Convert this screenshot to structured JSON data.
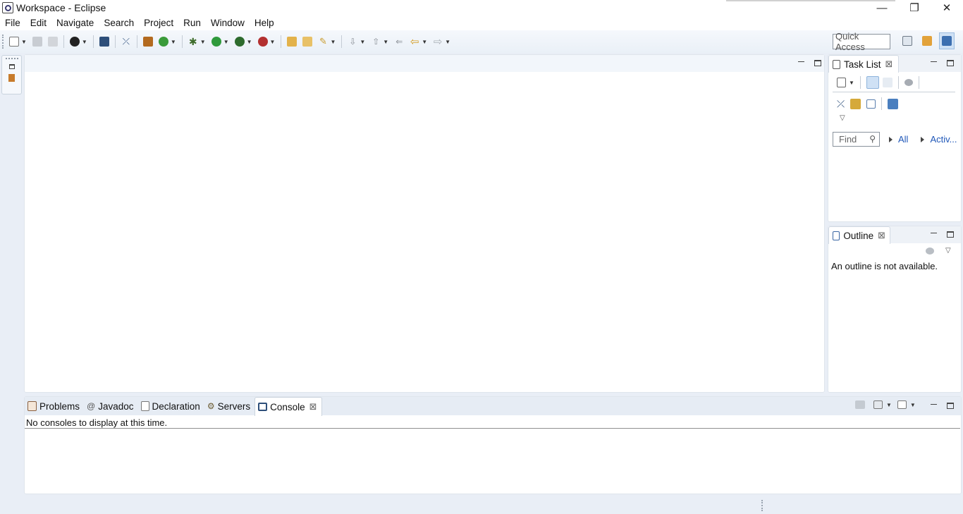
{
  "window": {
    "title": "Workspace - Eclipse",
    "controls": [
      "minimize-icon",
      "restore-icon",
      "close-icon"
    ]
  },
  "menu": [
    "File",
    "Edit",
    "Navigate",
    "Search",
    "Project",
    "Run",
    "Window",
    "Help"
  ],
  "toolbar": {
    "quick_access_placeholder": "Quick Access"
  },
  "task_list": {
    "title": "Task List",
    "find_placeholder": "Find",
    "filter_all": "All",
    "filter_active": "Activ..."
  },
  "outline": {
    "title": "Outline",
    "message": "An outline is not available."
  },
  "bottom_tabs": [
    {
      "label": "Problems",
      "icon": "problems-icon"
    },
    {
      "label": "Javadoc",
      "icon": "javadoc-icon"
    },
    {
      "label": "Declaration",
      "icon": "declaration-icon"
    },
    {
      "label": "Servers",
      "icon": "servers-icon"
    },
    {
      "label": "Console",
      "icon": "console-icon",
      "active": true
    }
  ],
  "console": {
    "message": "No consoles to display at this time."
  },
  "colors": {
    "accent_link": "#1f57b8",
    "background": "#e9eef6",
    "active_perspective": "#cfe1f5"
  }
}
